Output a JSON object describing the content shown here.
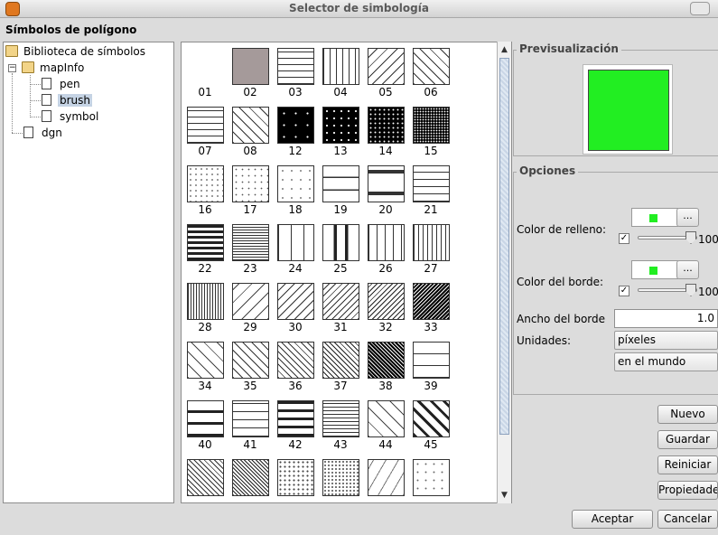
{
  "window": {
    "title": "Selector de simbología"
  },
  "section_title": "Símbolos de polígono",
  "tree": {
    "root": "Biblioteca de símbolos",
    "mapinfo": "mapInfo",
    "children": [
      "pen",
      "brush",
      "symbol"
    ],
    "dgn": "dgn",
    "selected": "brush"
  },
  "symbols": [
    {
      "label": "01",
      "pattern": "empty"
    },
    {
      "label": "02",
      "pattern": "solid-gray"
    },
    {
      "label": "03",
      "pattern": "horizontal"
    },
    {
      "label": "04",
      "pattern": "vertical"
    },
    {
      "label": "05",
      "pattern": "diagonal"
    },
    {
      "label": "06",
      "pattern": "backdiagonal"
    },
    {
      "label": "07",
      "pattern": "grid"
    },
    {
      "label": "08",
      "pattern": "crosshatch"
    },
    {
      "label": "12",
      "pattern": "black-dots-sparse"
    },
    {
      "label": "13",
      "pattern": "black-dots"
    },
    {
      "label": "14",
      "pattern": "black-dots-dense"
    },
    {
      "label": "15",
      "pattern": "black-fine"
    },
    {
      "label": "16",
      "pattern": "dots-light"
    },
    {
      "label": "17",
      "pattern": "dots-scatter"
    },
    {
      "label": "18",
      "pattern": "dots-sparse"
    },
    {
      "label": "19",
      "pattern": "double-line"
    },
    {
      "label": "20",
      "pattern": "thick-double"
    },
    {
      "label": "21",
      "pattern": "horizontal-wide"
    },
    {
      "label": "22",
      "pattern": "horizontal-thick"
    },
    {
      "label": "23",
      "pattern": "horizontal-fine"
    },
    {
      "label": "24",
      "pattern": "vertical-wide"
    },
    {
      "label": "25",
      "pattern": "vertical-thick"
    },
    {
      "label": "26",
      "pattern": "vertical-medium"
    },
    {
      "label": "27",
      "pattern": "vertical-double"
    },
    {
      "label": "28",
      "pattern": "vertical-fine"
    },
    {
      "label": "29",
      "pattern": "diagonal-light"
    },
    {
      "label": "30",
      "pattern": "diagonal-medium"
    },
    {
      "label": "31",
      "pattern": "diagonal-fine"
    },
    {
      "label": "32",
      "pattern": "diagonal-dense"
    },
    {
      "label": "33",
      "pattern": "diagonal-dark"
    },
    {
      "label": "34",
      "pattern": "backdiagonal-light"
    },
    {
      "label": "35",
      "pattern": "backdiagonal-medium"
    },
    {
      "label": "36",
      "pattern": "backdiagonal-fine"
    },
    {
      "label": "37",
      "pattern": "backdiagonal-dense"
    },
    {
      "label": "38",
      "pattern": "backdiagonal-dark"
    },
    {
      "label": "39",
      "pattern": "grid-double"
    },
    {
      "label": "40",
      "pattern": "grid-thick"
    },
    {
      "label": "41",
      "pattern": "grid-medium"
    },
    {
      "label": "42",
      "pattern": "grid-bold"
    },
    {
      "label": "43",
      "pattern": "grid-fine"
    },
    {
      "label": "44",
      "pattern": "crosshatch-light"
    },
    {
      "label": "45",
      "pattern": "crosshatch-bold"
    },
    {
      "label": "",
      "pattern": "crosshatch-fine"
    },
    {
      "label": "",
      "pattern": "crosshatch-dense"
    },
    {
      "label": "",
      "pattern": "dashes"
    },
    {
      "label": "",
      "pattern": "dashes-dense"
    },
    {
      "label": "",
      "pattern": "slashes"
    },
    {
      "label": "",
      "pattern": "slashes-sparse"
    }
  ],
  "preview": {
    "title": "Previsualización",
    "color": "#22ee22"
  },
  "options": {
    "title": "Opciones",
    "fill_color_label": "Color de relleno:",
    "fill_color": "#22ee22",
    "fill_opacity": "100",
    "fill_checked": true,
    "border_color_label": "Color del borde:",
    "border_color": "#22ee22",
    "border_opacity": "100",
    "border_checked": true,
    "ellipsis": "...",
    "border_width_label": "Ancho del borde",
    "border_width_value": "1.0",
    "units_label": "Unidades:",
    "units_value": "píxeles",
    "units_ref_value": "en el mundo"
  },
  "buttons": {
    "nuevo": "Nuevo",
    "guardar": "Guardar",
    "reiniciar": "Reiniciar",
    "propiedades": "Propiedades",
    "aceptar": "Aceptar",
    "cancelar": "Cancelar"
  }
}
